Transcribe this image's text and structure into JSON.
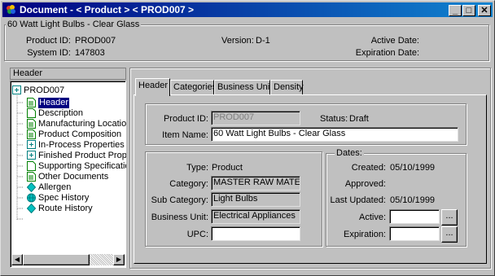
{
  "window": {
    "title": "Document - < Product > < PROD007 >",
    "min_label": "_",
    "max_label": "□",
    "close_label": "✕"
  },
  "summary": {
    "group_label": "60 Watt Light Bulbs - Clear Glass",
    "product_id_label": "Product ID:",
    "product_id_value": "PROD007",
    "system_id_label": "System ID:",
    "system_id_value": "147803",
    "version_label": "Version:",
    "version_value": "D-1",
    "active_date_label": "Active Date:",
    "expiration_date_label": "Expiration Date:"
  },
  "tree": {
    "header": "Header",
    "root": "PROD007",
    "items": [
      {
        "label": "Header",
        "icon": "document-green-icon",
        "selected": true
      },
      {
        "label": "Description",
        "icon": "document-icon"
      },
      {
        "label": "Manufacturing Location",
        "icon": "document-green-icon"
      },
      {
        "label": "Product Composition",
        "icon": "document-green-icon"
      },
      {
        "label": "In-Process Properties",
        "icon": "expand-icon"
      },
      {
        "label": "Finished Product Prope",
        "icon": "expand-icon"
      },
      {
        "label": "Supporting Specificatio",
        "icon": "document-icon"
      },
      {
        "label": "Other Documents",
        "icon": "document-green-icon"
      },
      {
        "label": "Allergen",
        "icon": "diamond-icon"
      },
      {
        "label": "Spec History",
        "icon": "globe-icon"
      },
      {
        "label": "Route History",
        "icon": "diamond-icon"
      }
    ]
  },
  "tabs": [
    "Header",
    "Categories",
    "Business Units",
    "Density"
  ],
  "form": {
    "product_id_label": "Product ID:",
    "product_id_value": "PROD007",
    "status_label": "Status:",
    "status_value": "Draft",
    "item_name_label": "Item Name:",
    "item_name_value": "60 Watt Light Bulbs - Clear Glass",
    "type_label": "Type:",
    "type_value": "Product",
    "category_label": "Category:",
    "category_value": "MASTER RAW MATERI",
    "sub_category_label": "Sub Category:",
    "sub_category_value": "Light Bulbs",
    "business_unit_label": "Business Unit:",
    "business_unit_value": "Electrical Appliances",
    "upc_label": "UPC:",
    "upc_value": ""
  },
  "dates": {
    "group_label": "Dates:",
    "created_label": "Created:",
    "created_value": "05/10/1999",
    "approved_label": "Approved:",
    "approved_value": "",
    "last_updated_label": "Last Updated:",
    "last_updated_value": "05/10/1999",
    "active_label": "Active:",
    "active_value": "",
    "expiration_label": "Expiration:",
    "expiration_value": "",
    "button_label": "..."
  },
  "colors": {
    "title_bar": "#000080",
    "selection": "#000080",
    "face": "#c0c0c0"
  }
}
